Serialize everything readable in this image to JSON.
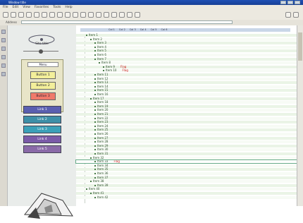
{
  "window": {
    "title": "Window title"
  },
  "menu": [
    "File",
    "Edit",
    "View",
    "Favorites",
    "Tools",
    "Help"
  ],
  "address": {
    "label": "Address",
    "value": ""
  },
  "nav": {
    "title": "Site title",
    "panel_header": "Menu",
    "panel_buttons": [
      {
        "label": "Button 1",
        "color": "#f3ef9a"
      },
      {
        "label": "Button 2",
        "color": "#f3ef9a"
      },
      {
        "label": "Button 3",
        "color": "#f07a6a"
      }
    ],
    "buttons": [
      {
        "label": "Link 1",
        "color": "#5a5fb0"
      },
      {
        "label": "Link 2",
        "color": "#3d8fa8"
      },
      {
        "label": "Link 3",
        "color": "#3aa0b8"
      },
      {
        "label": "Link 4",
        "color": "#7a5aa8"
      },
      {
        "label": "Link 5",
        "color": "#8a6aa8"
      }
    ]
  },
  "columns": [
    "Col 1",
    "Col 2",
    "Col 3",
    "Col 4",
    "Col 5",
    "Col 6"
  ],
  "rows": [
    {
      "text": "Item 1",
      "indent": 1,
      "highlight": false
    },
    {
      "text": "Item 2",
      "indent": 2,
      "highlight": false
    },
    {
      "text": "Item 3",
      "indent": 3,
      "highlight": false
    },
    {
      "text": "Item 4",
      "indent": 3,
      "highlight": false
    },
    {
      "text": "Item 5",
      "indent": 3,
      "highlight": false
    },
    {
      "text": "Item 6",
      "indent": 3,
      "highlight": false
    },
    {
      "text": "Item 7",
      "indent": 3,
      "highlight": false
    },
    {
      "text": "Item 8",
      "indent": 4,
      "highlight": false
    },
    {
      "text": "Item 9",
      "indent": 5,
      "highlight": false,
      "red": "Flag"
    },
    {
      "text": "Item 10",
      "indent": 5,
      "highlight": false,
      "red": "Flag"
    },
    {
      "text": "Item 11",
      "indent": 3,
      "highlight": false
    },
    {
      "text": "Item 12",
      "indent": 3,
      "highlight": false
    },
    {
      "text": "Item 13",
      "indent": 3,
      "highlight": false
    },
    {
      "text": "Item 14",
      "indent": 3,
      "highlight": false
    },
    {
      "text": "Item 15",
      "indent": 3,
      "highlight": false
    },
    {
      "text": "Item 16",
      "indent": 3,
      "highlight": false
    },
    {
      "text": "Item 17",
      "indent": 2,
      "highlight": false
    },
    {
      "text": "Item 18",
      "indent": 3,
      "highlight": false
    },
    {
      "text": "Item 19",
      "indent": 3,
      "highlight": false
    },
    {
      "text": "Item 20",
      "indent": 3,
      "highlight": false
    },
    {
      "text": "Item 21",
      "indent": 3,
      "highlight": false
    },
    {
      "text": "Item 22",
      "indent": 3,
      "highlight": false
    },
    {
      "text": "Item 23",
      "indent": 3,
      "highlight": false
    },
    {
      "text": "Item 24",
      "indent": 3,
      "highlight": false
    },
    {
      "text": "Item 25",
      "indent": 3,
      "highlight": false
    },
    {
      "text": "Item 26",
      "indent": 3,
      "highlight": false
    },
    {
      "text": "Item 27",
      "indent": 3,
      "highlight": false
    },
    {
      "text": "Item 28",
      "indent": 3,
      "highlight": false
    },
    {
      "text": "Item 29",
      "indent": 3,
      "highlight": false
    },
    {
      "text": "Item 30",
      "indent": 3,
      "highlight": false
    },
    {
      "text": "Item 31",
      "indent": 3,
      "highlight": false
    },
    {
      "text": "Item 32",
      "indent": 2,
      "highlight": false
    },
    {
      "text": "Item 33",
      "indent": 3,
      "highlight": true,
      "red": "Flag"
    },
    {
      "text": "Item 34",
      "indent": 3,
      "highlight": false
    },
    {
      "text": "Item 35",
      "indent": 3,
      "highlight": false
    },
    {
      "text": "Item 36",
      "indent": 3,
      "highlight": false
    },
    {
      "text": "Item 37",
      "indent": 3,
      "highlight": false
    },
    {
      "text": "Item 38",
      "indent": 2,
      "highlight": false
    },
    {
      "text": "Item 39",
      "indent": 3,
      "highlight": false
    },
    {
      "text": "Item 40",
      "indent": 1,
      "highlight": false
    },
    {
      "text": "Item 41",
      "indent": 2,
      "highlight": false
    },
    {
      "text": "Item 42",
      "indent": 3,
      "highlight": false
    }
  ],
  "colors": {
    "row_bg": "#eaf4e6",
    "row_alt": "#f7fbf5",
    "highlight": "#ffffff"
  }
}
